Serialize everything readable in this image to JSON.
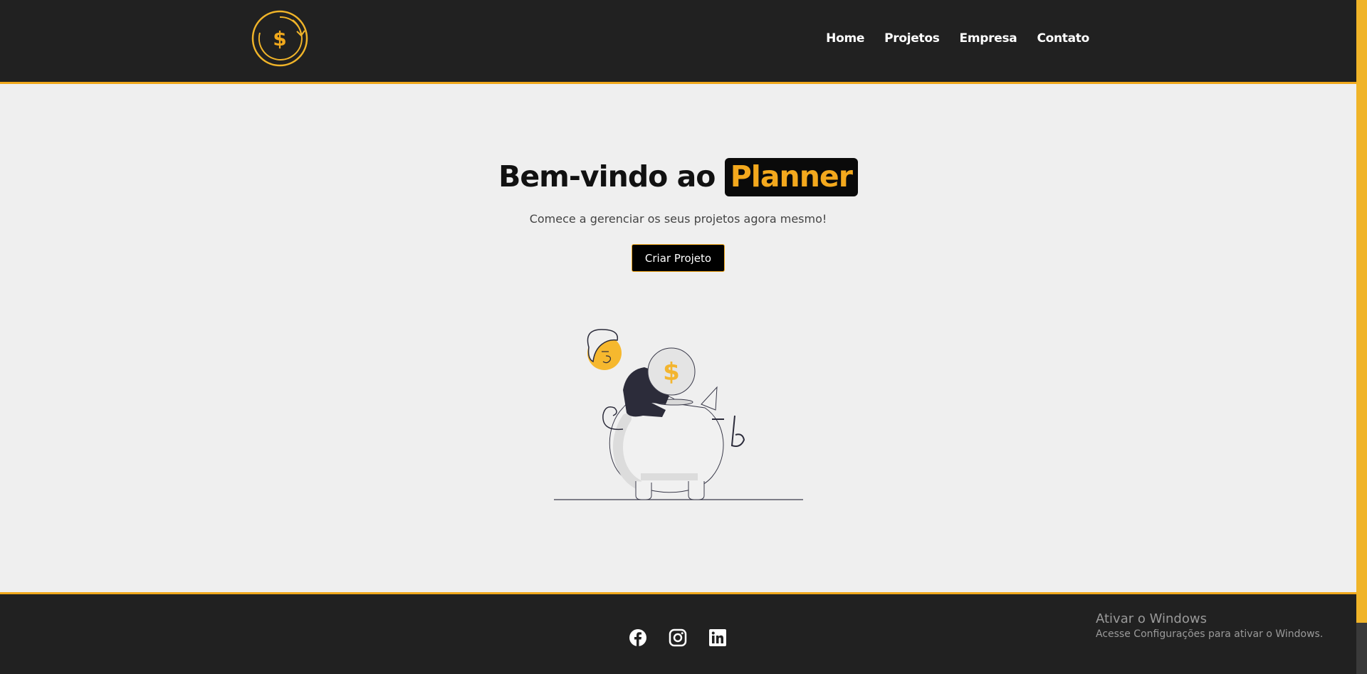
{
  "nav": {
    "items": [
      "Home",
      "Projetos",
      "Empresa",
      "Contato"
    ]
  },
  "logo": {
    "icon": "dollar-cycle-icon",
    "symbol": "$"
  },
  "hero": {
    "title_prefix": "Bem-vindo ao",
    "title_highlight": "Planner",
    "subtitle": "Comece a gerenciar os seus projetos agora mesmo!",
    "cta_label": "Criar Projeto"
  },
  "illustration": {
    "name": "piggy-bank-illustration",
    "coin_symbol": "$"
  },
  "footer": {
    "social": [
      "facebook-icon",
      "instagram-icon",
      "linkedin-icon"
    ]
  },
  "os_watermark": {
    "title": "Ativar o Windows",
    "subtitle": "Acesse Configurações para ativar o Windows."
  },
  "colors": {
    "accent": "#f0a81c",
    "dark": "#212121",
    "background": "#efefef"
  }
}
